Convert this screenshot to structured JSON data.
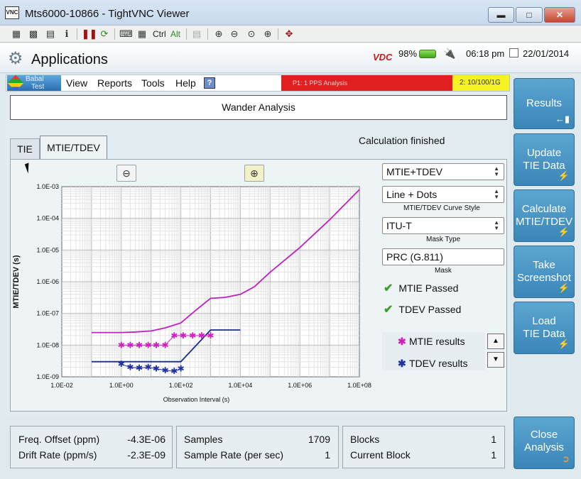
{
  "window": {
    "title": "Mts6000-10866 - TightVNC Viewer",
    "icon_text": "VNC",
    "buttons": [
      "minimize",
      "maximize",
      "close"
    ]
  },
  "vnc_toolbar": {
    "ctrl_label": "Ctrl",
    "alt_label": "Alt",
    "icons": [
      "new-connection-icon",
      "save-icon",
      "options-icon",
      "info-icon",
      "pause-icon",
      "refresh-icon",
      "ctrl-alt-del-icon",
      "ctrl-esc-icon",
      "clipboard-icon",
      "zoom-in-icon",
      "zoom-out-icon",
      "zoom-100-icon",
      "zoom-fit-icon",
      "fullscreen-icon"
    ]
  },
  "app_header": {
    "title": "Applications",
    "battery_percent": "98%",
    "time": "06:18 pm",
    "date": "22/01/2014",
    "brand": "VDC"
  },
  "menu": {
    "logo_line1": "Babal",
    "logo_line2": "Test",
    "items": [
      "View",
      "Reports",
      "Tools",
      "Help"
    ],
    "help_icon": "?",
    "status_port1": "P1: 1 PPS Analysis",
    "status_port2": "2: 10/100/1G"
  },
  "main": {
    "header": "Wander Analysis",
    "tabs": [
      {
        "label": "TIE",
        "active": false
      },
      {
        "label": "MTIE/TDEV",
        "active": true
      }
    ],
    "calc_status": "Calculation finished"
  },
  "controls": {
    "display_select": "MTIE+TDEV",
    "curve_style_select": "Line + Dots",
    "curve_style_label": "MTIE/TDEV Curve Style",
    "mask_type_select": "ITU-T",
    "mask_type_label": "Mask Type",
    "mask_select": "PRC (G.811)",
    "mask_label": "Mask",
    "mtie_status": "MTIE Passed",
    "tdev_status": "TDEV Passed",
    "legend": [
      {
        "label": "MTIE results",
        "color": "#d020c0"
      },
      {
        "label": "TDEV results",
        "color": "#2030a0"
      }
    ]
  },
  "chart_data": {
    "type": "line",
    "xlabel": "Observation Interval (s)",
    "ylabel": "MTIE/TDEV (s)",
    "x_scale": "log",
    "y_scale": "log",
    "xlim": [
      0.01,
      100000000
    ],
    "ylim": [
      1e-09,
      0.001
    ],
    "x_ticks": [
      "1.0E-02",
      "1.0E+00",
      "1.0E+02",
      "1.0E+04",
      "1.0E+06",
      "1.0E+08"
    ],
    "y_ticks": [
      "1.0E-03",
      "1.0E-04",
      "1.0E-05",
      "1.0E-06",
      "1.0E-07",
      "1.0E-08",
      "1.0E-09"
    ],
    "grid": true,
    "series": [
      {
        "kind": "mask-line",
        "color": "#c020c0",
        "x": [
          0.1,
          1,
          3,
          10,
          30,
          100,
          300,
          1000,
          3000,
          10000,
          30000,
          100000,
          1000000,
          10000000,
          100000000
        ],
        "y": [
          2.5e-08,
          2.5e-08,
          2.6e-08,
          2.8e-08,
          3.5e-08,
          5e-08,
          1.2e-07,
          3e-07,
          3.2e-07,
          4e-07,
          7e-07,
          2e-06,
          1.2e-05,
          9e-05,
          0.0008
        ]
      },
      {
        "kind": "mask-line",
        "color": "#1a2a90",
        "x": [
          0.1,
          1,
          10,
          60,
          100,
          1000,
          10000
        ],
        "y": [
          3e-09,
          3e-09,
          3e-09,
          3e-09,
          3e-09,
          3e-08,
          3e-08
        ]
      },
      {
        "name": "MTIE results",
        "kind": "points",
        "color": "#d020c0",
        "x": [
          1,
          2,
          4,
          8,
          15,
          30,
          60,
          120,
          250,
          500,
          1000
        ],
        "y": [
          1e-08,
          1e-08,
          1e-08,
          1e-08,
          1e-08,
          1e-08,
          2e-08,
          2e-08,
          2e-08,
          2e-08,
          2e-08
        ]
      },
      {
        "name": "TDEV results",
        "kind": "points",
        "color": "#2030a0",
        "x": [
          1,
          2,
          4,
          8,
          15,
          30,
          60,
          100
        ],
        "y": [
          2.5e-09,
          2e-09,
          1.9e-09,
          2e-09,
          1.8e-09,
          1.6e-09,
          1.5e-09,
          1.8e-09
        ]
      }
    ]
  },
  "sidebar": [
    {
      "line1": "Results",
      "line2": "",
      "icon": "arrow-left-icon"
    },
    {
      "line1": "Update",
      "line2": "TIE Data",
      "icon": "lightning-icon"
    },
    {
      "line1": "Calculate",
      "line2": "MTIE/TDEV",
      "icon": "lightning-icon"
    },
    {
      "line1": "Take",
      "line2": "Screenshot",
      "icon": "lightning-icon"
    },
    {
      "line1": "Load",
      "line2": "TIE Data",
      "icon": "lightning-icon"
    },
    {
      "line1": "Close",
      "line2": "Analysis",
      "icon": "exit-icon"
    }
  ],
  "bottom": {
    "freq_offset_label": "Freq. Offset (ppm)",
    "freq_offset_value": "-4.3E-06",
    "drift_rate_label": "Drift Rate (ppm/s)",
    "drift_rate_value": "-2.3E-09",
    "samples_label": "Samples",
    "samples_value": "1709",
    "sample_rate_label": "Sample Rate (per sec)",
    "sample_rate_value": "1",
    "blocks_label": "Blocks",
    "blocks_value": "1",
    "current_block_label": "Current Block",
    "current_block_value": "1"
  }
}
